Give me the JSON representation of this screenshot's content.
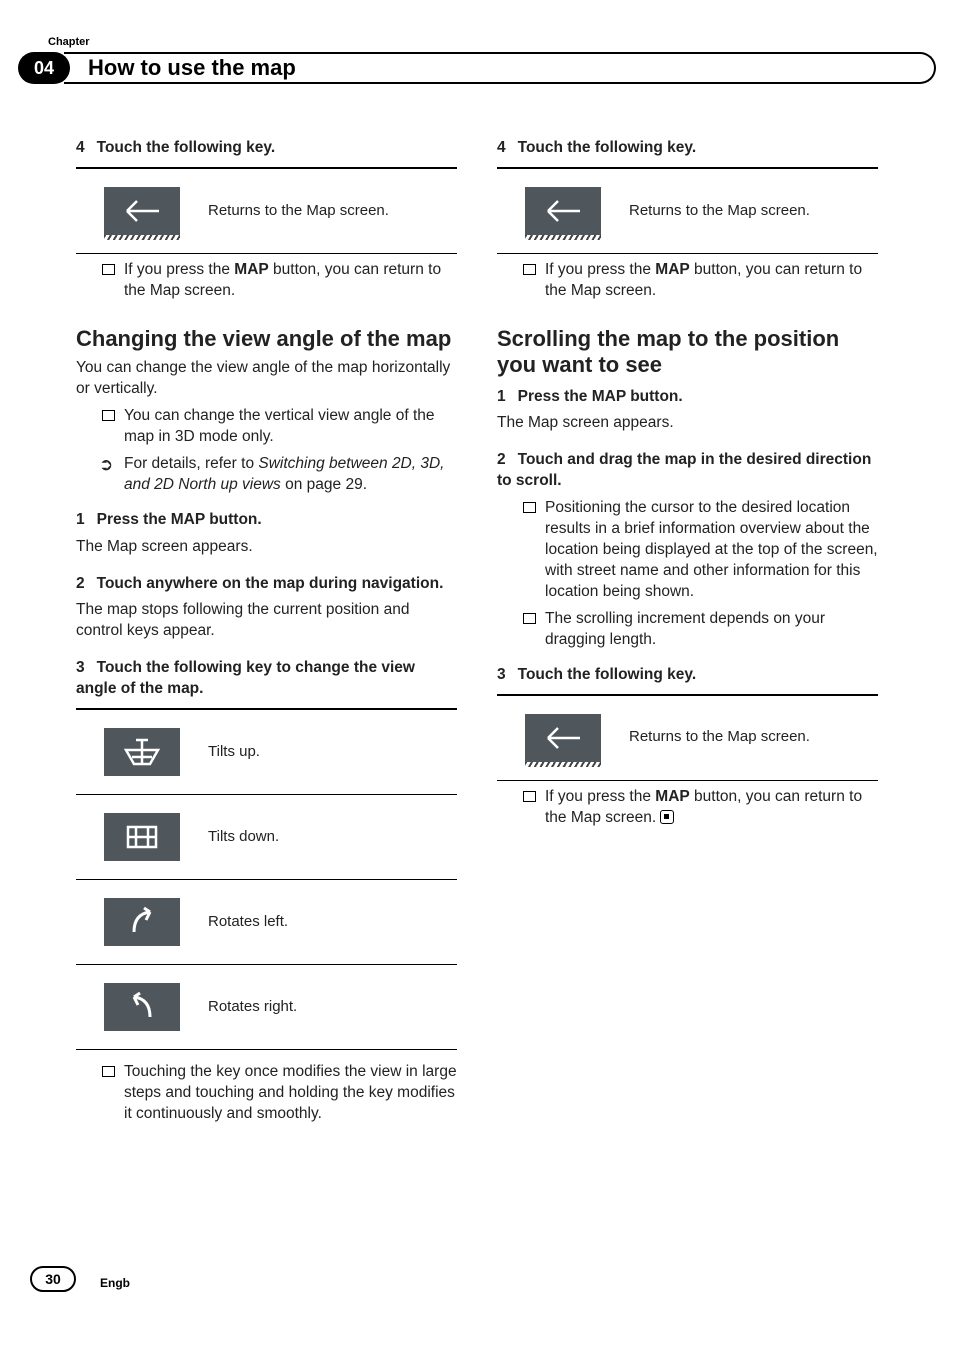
{
  "header": {
    "chapter_label": "Chapter",
    "chapter_number": "04",
    "title": "How to use the map"
  },
  "left": {
    "step4": {
      "n": "4",
      "text": "Touch the following key."
    },
    "key_back": {
      "desc": "Returns to the Map screen."
    },
    "note_map_button": {
      "p1": "If you press the ",
      "map": "MAP",
      "p2": " button, you can return to the Map screen."
    },
    "sec1_title": "Changing the view angle of the map",
    "sec1_intro": "You can change the view angle of the map horizontally or vertically.",
    "sec1_note1": "You can change the vertical view angle of the map in 3D mode only.",
    "sec1_ref": {
      "p1": "For details, refer to ",
      "em": "Switching between 2D, 3D, and 2D North up views",
      "p2": " on page 29."
    },
    "sec1_step1": {
      "n": "1",
      "text": "Press the MAP button."
    },
    "sec1_step1_body": "The Map screen appears.",
    "sec1_step2": {
      "n": "2",
      "text": "Touch anywhere on the map during navigation."
    },
    "sec1_step2_body": "The map stops following the current position and control keys appear.",
    "sec1_step3": {
      "n": "3",
      "text": "Touch the following key to change the view angle of the map."
    },
    "keys": {
      "tilt_up": "Tilts up.",
      "tilt_down": "Tilts down.",
      "rotate_left": "Rotates left.",
      "rotate_right": "Rotates right."
    },
    "sec1_note_after": "Touching the key once modifies the view in large steps and touching and holding the key modifies it continuously and smoothly."
  },
  "right": {
    "step4": {
      "n": "4",
      "text": "Touch the following key."
    },
    "key_back": {
      "desc": "Returns to the Map screen."
    },
    "note_map_button": {
      "p1": "If you press the ",
      "map": "MAP",
      "p2": " button, you can return to the Map screen."
    },
    "sec2_title": "Scrolling the map to the position you want to see",
    "sec2_step1": {
      "n": "1",
      "text": "Press the MAP button."
    },
    "sec2_step1_body": "The Map screen appears.",
    "sec2_step2": {
      "n": "2",
      "text": "Touch and drag the map in the desired direction to scroll."
    },
    "sec2_note1": "Positioning the cursor to the desired location results in a brief information overview about the location being displayed at the top of the screen, with street name and other information for this location being shown.",
    "sec2_note2": "The scrolling increment depends on your dragging length.",
    "sec2_step3": {
      "n": "3",
      "text": "Touch the following key."
    },
    "key_back2": {
      "desc": "Returns to the Map screen."
    },
    "note_map_button2": {
      "p1": "If you press the ",
      "map": "MAP",
      "p2": " button, you can return to the Map screen."
    }
  },
  "footer": {
    "page": "30",
    "lang": "Engb"
  }
}
